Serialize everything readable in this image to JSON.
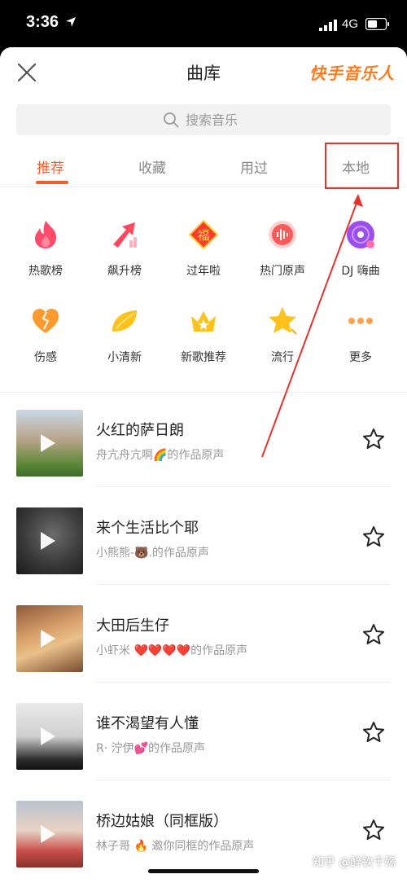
{
  "status_bar": {
    "time": "3:36",
    "network": "4G"
  },
  "header": {
    "title": "曲库",
    "brand": "快手音乐人"
  },
  "search": {
    "placeholder": "搜索音乐"
  },
  "tabs": [
    {
      "label": "推荐",
      "active": true
    },
    {
      "label": "收藏",
      "active": false
    },
    {
      "label": "用过",
      "active": false
    },
    {
      "label": "本地",
      "active": false
    }
  ],
  "categories": [
    {
      "label": "热歌榜",
      "icon": "flame-icon"
    },
    {
      "label": "飙升榜",
      "icon": "rising-arrow-icon"
    },
    {
      "label": "过年啦",
      "icon": "fu-icon",
      "icon_text": "福"
    },
    {
      "label": "热门原声",
      "icon": "audio-wave-icon"
    },
    {
      "label": "DJ 嗨曲",
      "icon": "vinyl-icon"
    },
    {
      "label": "伤感",
      "icon": "broken-heart-icon"
    },
    {
      "label": "小清新",
      "icon": "leaf-icon"
    },
    {
      "label": "新歌推荐",
      "icon": "crown-icon"
    },
    {
      "label": "流行",
      "icon": "star-badge-icon"
    },
    {
      "label": "更多",
      "icon": "more-dots-icon"
    }
  ],
  "songs": [
    {
      "name": "火红的萨日朗",
      "author": "舟亢舟亢啊🌈的作品原声"
    },
    {
      "name": "来个生活比个耶",
      "author": "小熊熊-🐻.的作品原声"
    },
    {
      "name": "大田后生仔",
      "author": "小虾米 ❤️❤️❤️❤️的作品原声"
    },
    {
      "name": "谁不渴望有人懂",
      "author": "R· 泞伊💕的作品原声"
    },
    {
      "name": "桥边姑娘（同框版）",
      "author": "林子哥 🔥 邀你同框的作品原声"
    }
  ],
  "watermark": "知乎 @醉钦千殇",
  "colors": {
    "accent": "#ff5a24",
    "brand": "#ff7a1a",
    "annotation": "#e8312b"
  }
}
